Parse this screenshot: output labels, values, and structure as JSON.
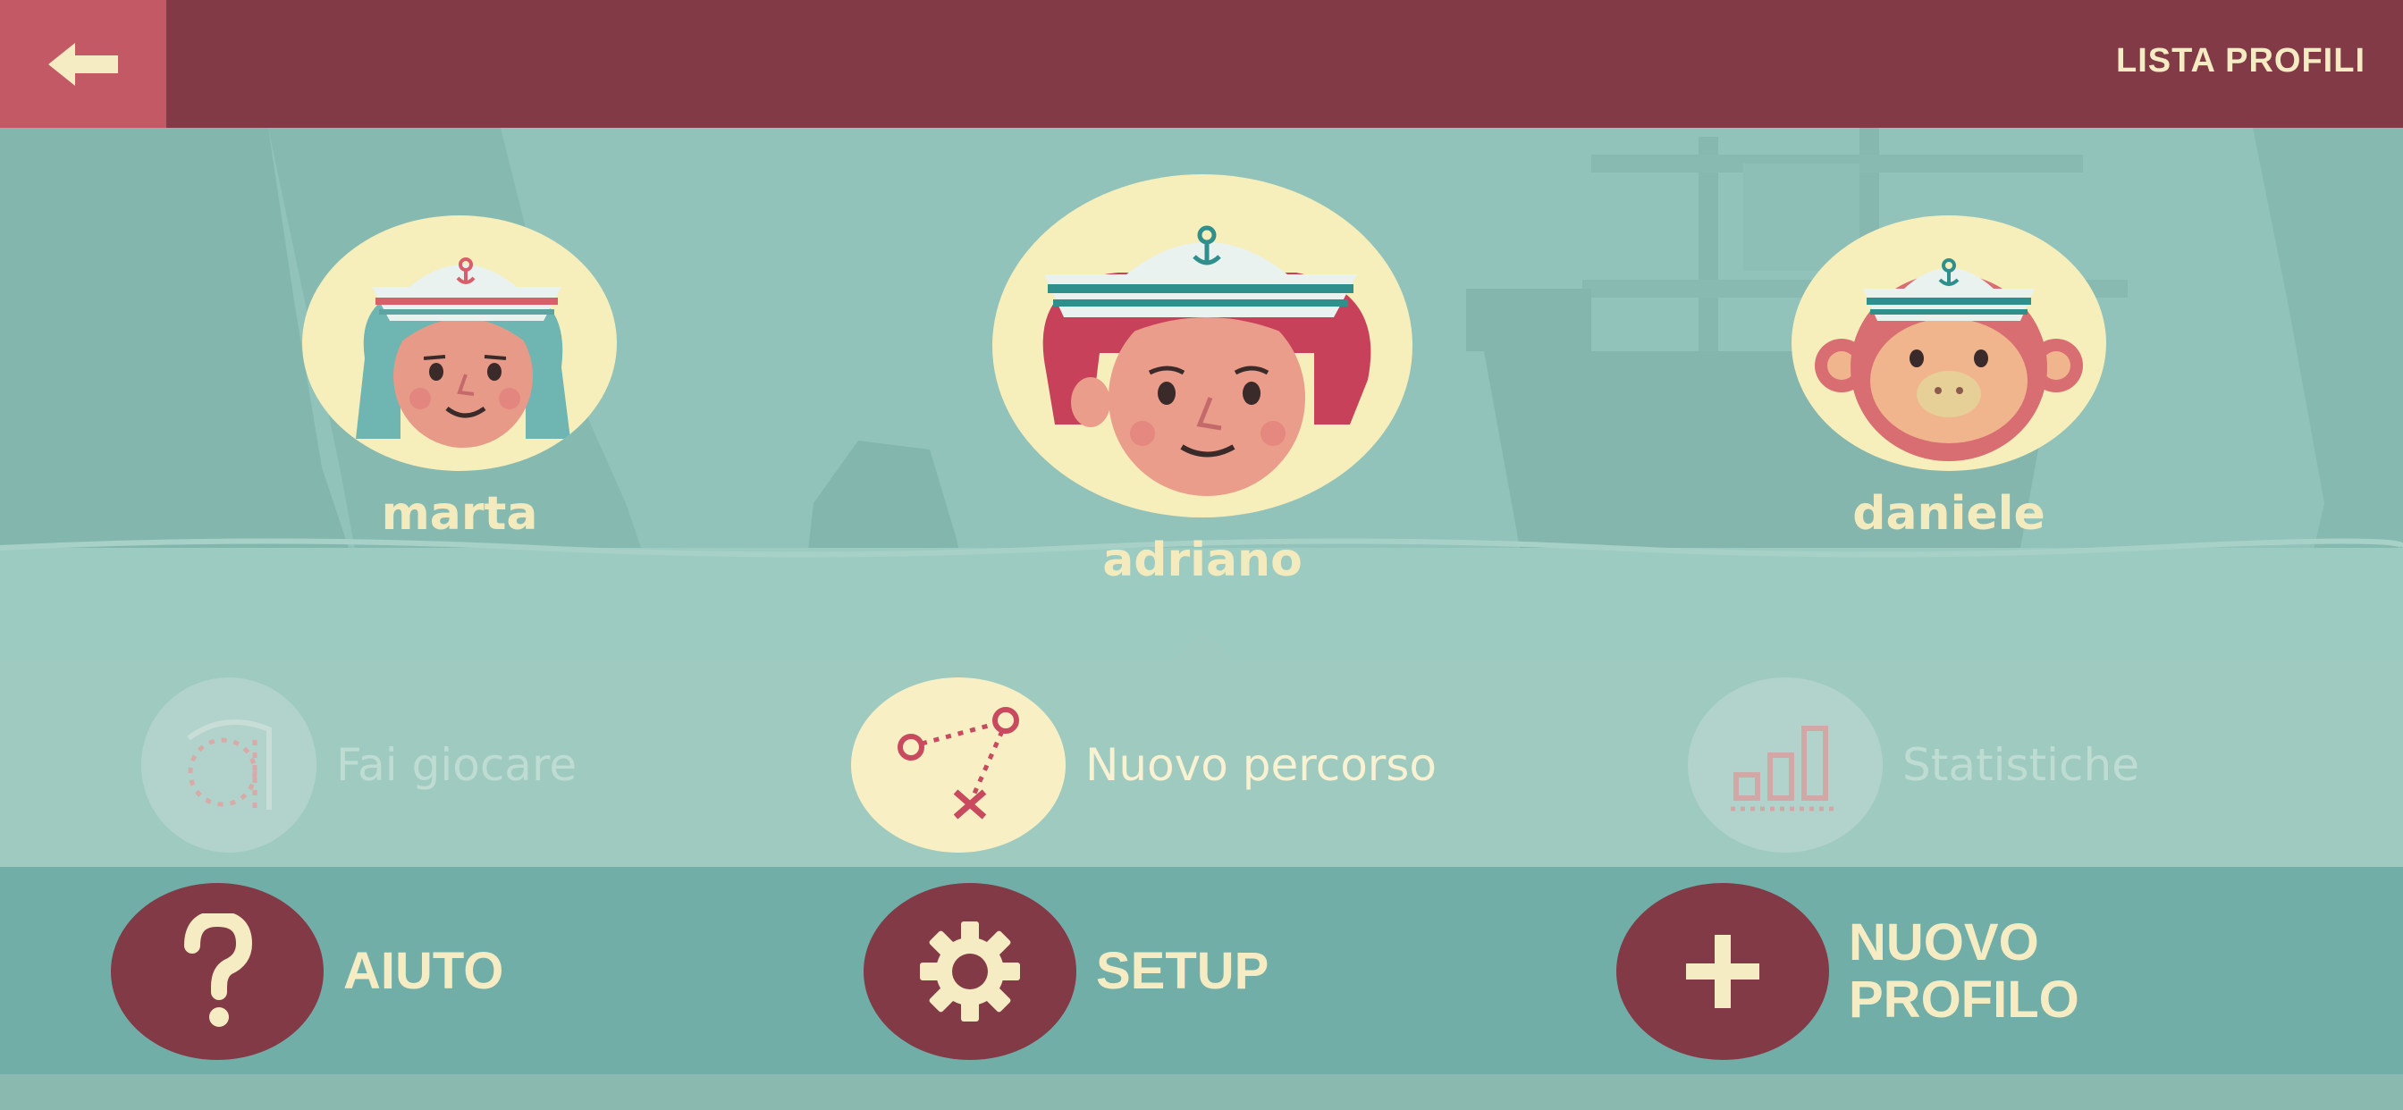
{
  "header": {
    "title": "LISTA PROFILI",
    "back_icon": "arrow-left-icon"
  },
  "profiles": [
    {
      "name": "marta",
      "avatar": "girl-sailor-avatar",
      "selected": false
    },
    {
      "name": "adriano",
      "avatar": "boy-sailor-avatar",
      "selected": true
    },
    {
      "name": "daniele",
      "avatar": "monkey-sailor-avatar",
      "selected": false
    }
  ],
  "actions": [
    {
      "label": "Fai giocare",
      "icon": "letter-a-tracing-icon",
      "enabled": false
    },
    {
      "label": "Nuovo percorso",
      "icon": "path-map-icon",
      "enabled": true
    },
    {
      "label": "Statistiche",
      "icon": "bar-chart-icon",
      "enabled": false
    }
  ],
  "menu": {
    "help_label": "AIUTO",
    "setup_label": "SETUP",
    "new_profile_label": "NUOVO\nPROFILO"
  },
  "colors": {
    "topbar": "#833a47",
    "back_button": "#c25964",
    "scene": "#8fc1b8",
    "accent_cream": "#f6ecc4",
    "button_maroon": "#833a47"
  }
}
